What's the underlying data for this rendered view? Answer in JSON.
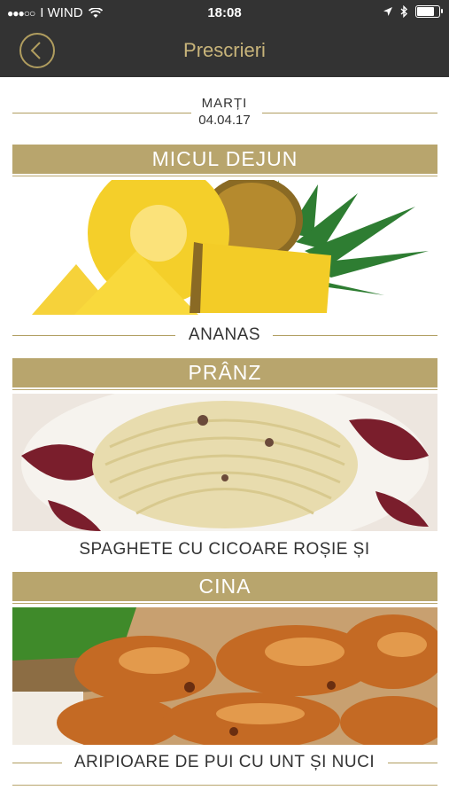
{
  "status": {
    "carrier": "I WIND",
    "time": "18:08"
  },
  "nav": {
    "title": "Prescrieri"
  },
  "date": {
    "day": "MARȚI",
    "value": "04.04.17"
  },
  "meals": [
    {
      "title": "MICUL DEJUN",
      "caption": "ANANAS"
    },
    {
      "title": "PRÂNZ",
      "caption": "SPAGHETE CU CICOARE ROȘIE ȘI"
    },
    {
      "title": "CINA",
      "caption": "ARIPIOARE DE PUI CU UNT ȘI NUCI"
    }
  ],
  "colors": {
    "bar": "#333333",
    "accent": "#b8a56d",
    "title": "#c8b47a"
  }
}
